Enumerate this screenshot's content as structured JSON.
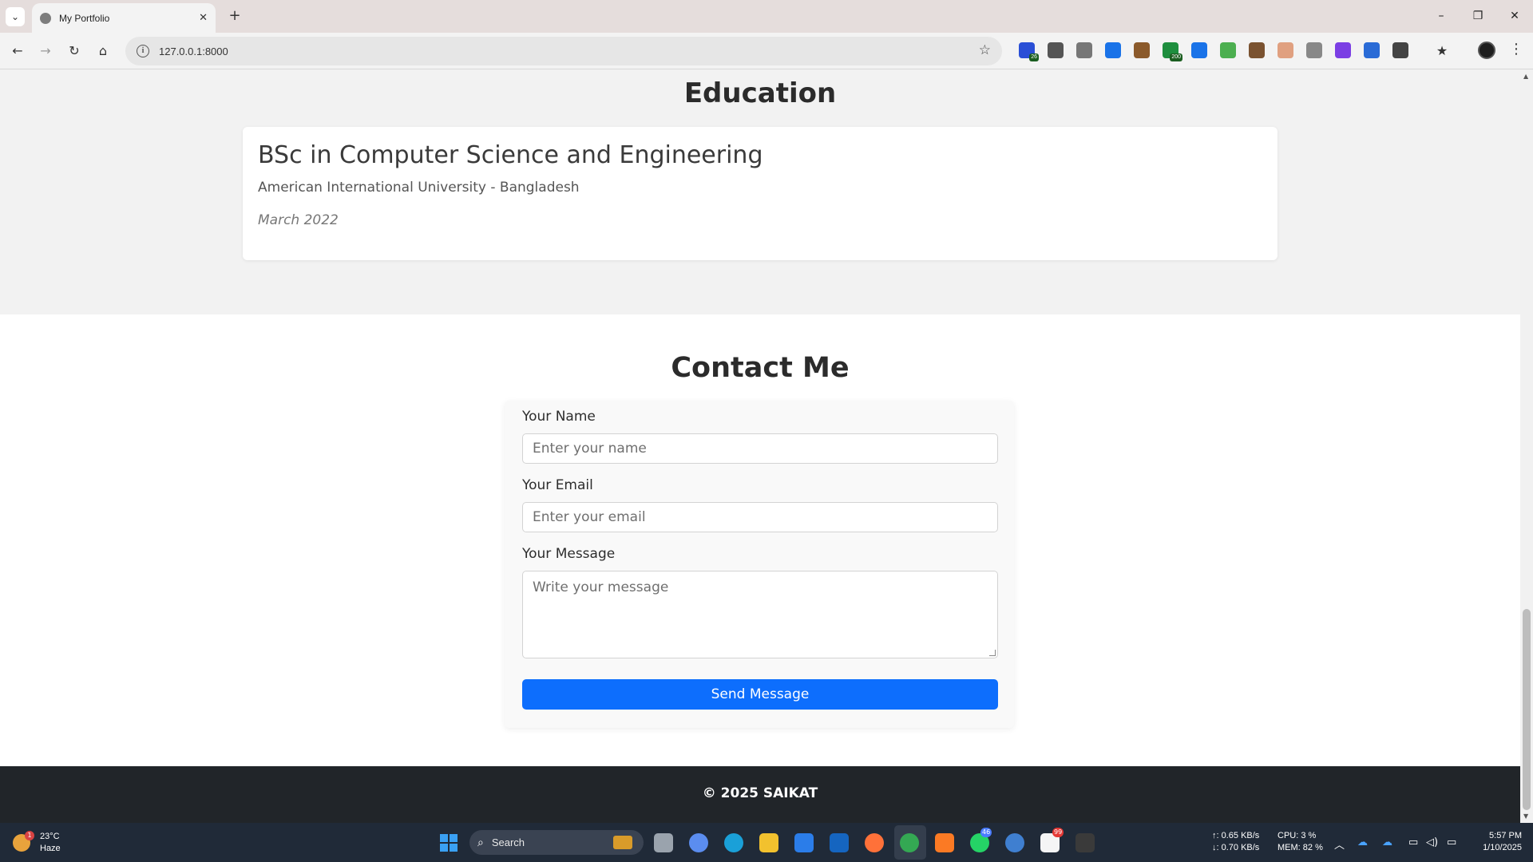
{
  "browser": {
    "tab_title": "My Portfolio",
    "new_tab_symbol": "+",
    "url": "127.0.0.1:8000",
    "window_controls": {
      "minimize": "–",
      "restore": "❐",
      "close": "✕"
    },
    "extensions": [
      {
        "name": "extension-graduation-icon",
        "color": "#2a4fd6",
        "badge": "26"
      },
      {
        "name": "extension-wordpress-icon",
        "color": "#555555"
      },
      {
        "name": "extension-camera-icon",
        "color": "#777777"
      },
      {
        "name": "extension-download-icon",
        "color": "#1a73e8"
      },
      {
        "name": "extension-cookie-icon",
        "color": "#8b5a2b"
      },
      {
        "name": "extension-green-icon",
        "color": "#1e8e3e",
        "badge": "200"
      },
      {
        "name": "extension-pen-icon",
        "color": "#1a73e8"
      },
      {
        "name": "extension-mail-icon",
        "color": "#4caf50"
      },
      {
        "name": "extension-owl-icon",
        "color": "#7a5230"
      },
      {
        "name": "extension-avatar-icon",
        "color": "#e0a080"
      },
      {
        "name": "extension-code-icon",
        "color": "#888888"
      },
      {
        "name": "extension-purple-icon",
        "color": "#7b3fe4"
      },
      {
        "name": "extension-translate-icon",
        "color": "#2a6bd6"
      },
      {
        "name": "extensions-puzzle-icon",
        "color": "#444444"
      }
    ]
  },
  "education": {
    "heading": "Education",
    "degree": "BSc in Computer Science and Engineering",
    "school": "American International University - Bangladesh",
    "date": "March 2022"
  },
  "contact": {
    "heading": "Contact Me",
    "name_label": "Your Name",
    "name_placeholder": "Enter your name",
    "email_label": "Your Email",
    "email_placeholder": "Enter your email",
    "message_label": "Your Message",
    "message_placeholder": "Write your message",
    "submit_label": "Send Message"
  },
  "footer": {
    "text": "© 2025 SAIKAT"
  },
  "taskbar": {
    "weather_temp": "23°C",
    "weather_desc": "Haze",
    "weather_badge": "1",
    "search_label": "Search",
    "net_up": "↑: 0.65 KB/s",
    "net_down": "↓: 0.70 KB/s",
    "cpu": "CPU: 3 %",
    "mem": "MEM: 82 %",
    "time": "5:57 PM",
    "date": "1/10/2025",
    "whatsapp_badge": "46",
    "notion_badge": "99",
    "apps": [
      {
        "name": "task-view-icon",
        "color": "#9aa3ad"
      },
      {
        "name": "copilot-icon",
        "color": "#5b8def"
      },
      {
        "name": "edge-icon",
        "color": "#1aa0d8"
      },
      {
        "name": "file-explorer-icon",
        "color": "#f2c12e"
      },
      {
        "name": "store-icon",
        "color": "#2b7de9"
      },
      {
        "name": "outlook-icon",
        "color": "#1565c0"
      },
      {
        "name": "firefox-icon",
        "color": "#ff7139"
      },
      {
        "name": "chrome-icon",
        "color": "#34a853"
      },
      {
        "name": "xampp-icon",
        "color": "#fb7a24"
      },
      {
        "name": "whatsapp-icon",
        "color": "#25d366"
      },
      {
        "name": "qbittorrent-icon",
        "color": "#3f7fd0"
      },
      {
        "name": "notion-icon",
        "color": "#f5f5f5"
      },
      {
        "name": "terminal-icon",
        "color": "#3a3a3a"
      }
    ]
  }
}
